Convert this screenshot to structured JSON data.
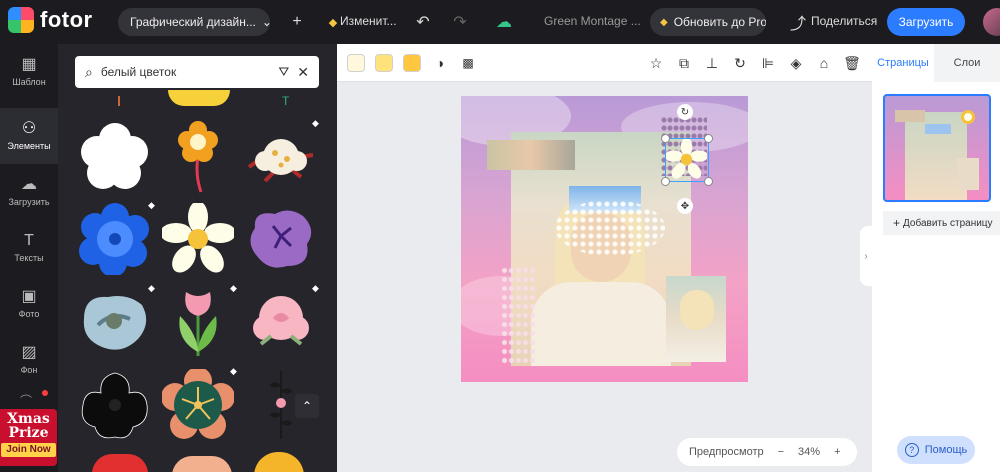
{
  "topbar": {
    "logo_text": "fotor",
    "design_type": "Графический дизайн...",
    "change_label": "Изменит...",
    "project_name": "Green Montage ...",
    "upgrade_label": "Обновить до Pro",
    "share_label": "Поделиться",
    "download_label": "Загрузить"
  },
  "leftnav": {
    "items": [
      {
        "label": "Шаблон",
        "icon": "template-icon"
      },
      {
        "label": "Элементы",
        "icon": "elements-icon"
      },
      {
        "label": "Загрузить",
        "icon": "upload-icon"
      },
      {
        "label": "Тексты",
        "icon": "text-icon"
      },
      {
        "label": "Фото",
        "icon": "photo-icon"
      },
      {
        "label": "Фон",
        "icon": "background-icon"
      }
    ],
    "promo": {
      "line1": "Xmas",
      "line2": "Prize",
      "cta": "Join Now"
    }
  },
  "panel": {
    "search_value": "белый цветок"
  },
  "workspace": {
    "preview_label": "Предпросмотр",
    "zoom": "34%",
    "minus": "−",
    "plus": "+"
  },
  "rpanel": {
    "tab_pages": "Страницы",
    "tab_layers": "Слои",
    "add_page": "Добавить страницу"
  },
  "help_label": "Помощь",
  "colors": {
    "accent": "#2b7cff",
    "swatch1": "#fff8dc",
    "swatch2": "#ffe27a",
    "swatch3": "#ffc640"
  }
}
